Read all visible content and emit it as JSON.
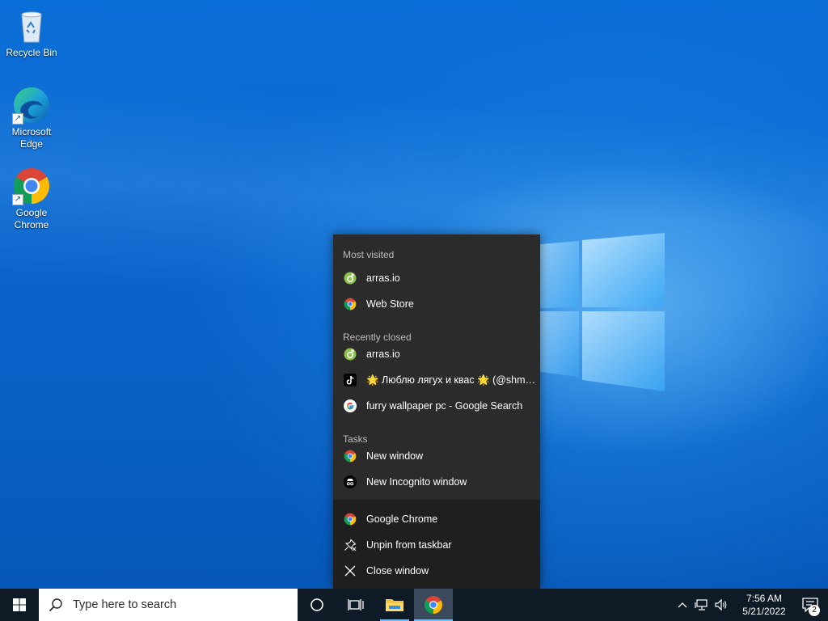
{
  "desktop": {
    "icons": [
      {
        "label": "Recycle Bin",
        "icon": "recycle-bin-icon"
      },
      {
        "label": "Microsoft Edge",
        "icon": "edge-icon"
      },
      {
        "label": "Google Chrome",
        "icon": "chrome-icon"
      }
    ]
  },
  "jumplist": {
    "most_visited_header": "Most visited",
    "most_visited": [
      {
        "label": "arras.io",
        "icon": "arras-favicon"
      },
      {
        "label": "Web Store",
        "icon": "chrome-icon"
      }
    ],
    "recently_closed_header": "Recently closed",
    "recently_closed": [
      {
        "label": "arras.io",
        "icon": "arras-favicon"
      },
      {
        "label": "🌟 Люблю лягух и квас 🌟 (@shmel_p...",
        "icon": "tiktok-icon"
      },
      {
        "label": "furry wallpaper pc - Google Search",
        "icon": "google-icon"
      }
    ],
    "tasks_header": "Tasks",
    "tasks": [
      {
        "label": "New window",
        "icon": "chrome-icon"
      },
      {
        "label": "New Incognito window",
        "icon": "incognito-icon"
      }
    ],
    "app_actions": [
      {
        "label": "Google Chrome",
        "icon": "chrome-icon"
      },
      {
        "label": "Unpin from taskbar",
        "icon": "unpin-icon"
      },
      {
        "label": "Close window",
        "icon": "close-icon"
      }
    ]
  },
  "taskbar": {
    "search_placeholder": "Type here to search",
    "clock_time": "7:56 AM",
    "clock_date": "5/21/2022",
    "notification_count": "2"
  },
  "colors": {
    "jumplist_bg": "#2b2b2b",
    "taskbar_bg": "#0f1a27",
    "accent": "#76b9ed"
  }
}
